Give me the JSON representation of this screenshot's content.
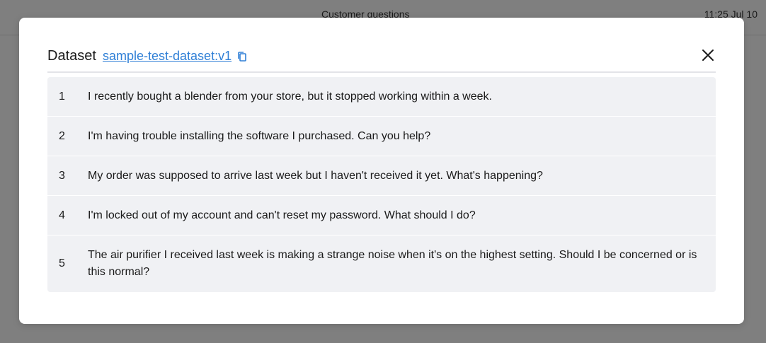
{
  "background": {
    "title": "Customer questions",
    "time": "11:25 Jul 10"
  },
  "modal": {
    "label": "Dataset",
    "dataset_name": "sample-test-dataset:v1",
    "rows": [
      {
        "index": "1",
        "text": "I recently bought a blender from your store, but it stopped working within a week."
      },
      {
        "index": "2",
        "text": "I'm having trouble installing the software I purchased. Can you help?"
      },
      {
        "index": "3",
        "text": "My order was supposed to arrive last week but I haven't received it yet. What's happening?"
      },
      {
        "index": "4",
        "text": "I'm locked out of my account and can't reset my password. What should I do?"
      },
      {
        "index": "5",
        "text": "The air purifier I received last week is making a strange noise when it's on the highest setting. Should I be concerned or is this normal?"
      }
    ]
  },
  "icons": {
    "copy": "copy-icon",
    "close": "close-icon"
  },
  "colors": {
    "overlay": "#7f7f7f",
    "link": "#2f7fd6",
    "row_background": "#f0f1f4"
  }
}
